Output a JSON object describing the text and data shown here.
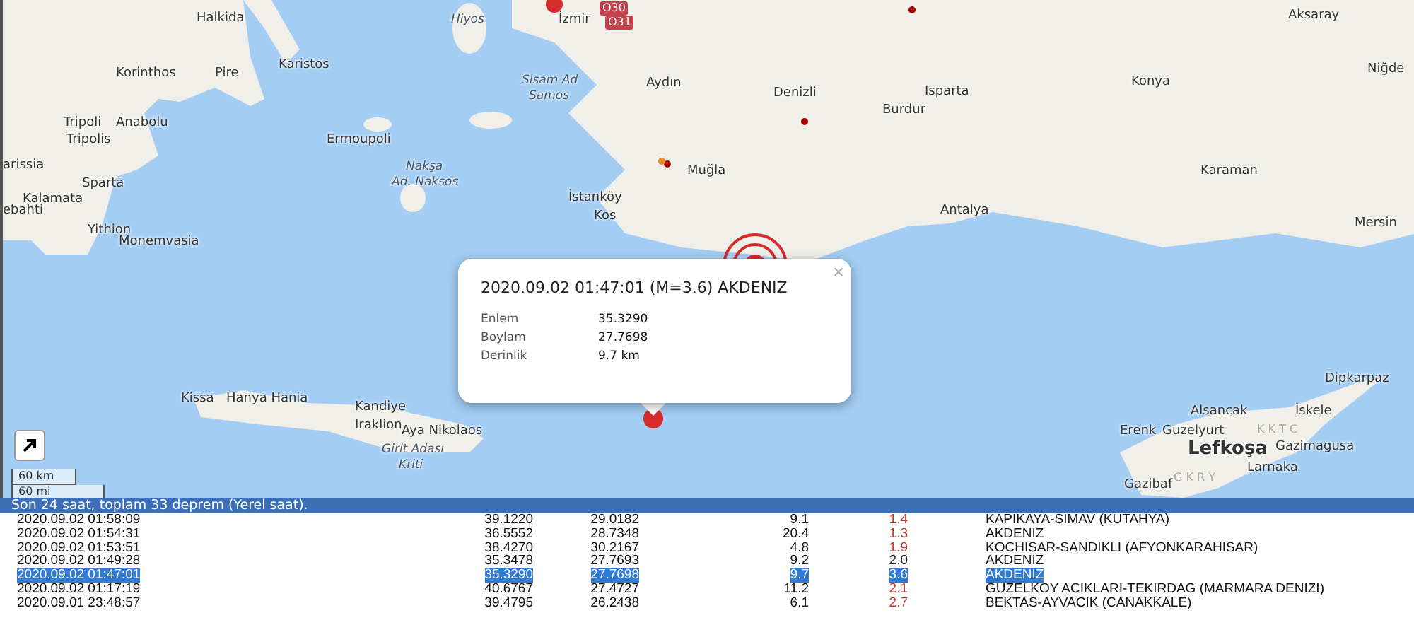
{
  "map": {
    "labels": [
      {
        "text": "Halkida",
        "kind": "city"
      },
      {
        "text": "Korinthos",
        "kind": "city"
      },
      {
        "text": "Pire",
        "kind": "city"
      },
      {
        "text": "Karistos",
        "kind": "city"
      },
      {
        "text": "Tripoli",
        "kind": "city"
      },
      {
        "text": "Anabolu",
        "kind": "city"
      },
      {
        "text": "Tripolis",
        "kind": "city"
      },
      {
        "text": "arissia",
        "kind": "city"
      },
      {
        "text": "Kalamata",
        "kind": "city"
      },
      {
        "text": "Sparta",
        "kind": "city"
      },
      {
        "text": "ebahti",
        "kind": "city"
      },
      {
        "text": "Yithion",
        "kind": "city"
      },
      {
        "text": "Monemvasia",
        "kind": "city"
      },
      {
        "text": "Ermoupoli",
        "kind": "city"
      },
      {
        "text": "Nakşa",
        "kind": "island"
      },
      {
        "text": "Ad. Naksos",
        "kind": "island"
      },
      {
        "text": "Hiyos",
        "kind": "island"
      },
      {
        "text": "İzmir",
        "kind": "city"
      },
      {
        "text": "Sisam Ad",
        "kind": "island"
      },
      {
        "text": "Samos",
        "kind": "island"
      },
      {
        "text": "Aydın",
        "kind": "city"
      },
      {
        "text": "İstanköy",
        "kind": "city"
      },
      {
        "text": "Kos",
        "kind": "city"
      },
      {
        "text": "Muğla",
        "kind": "city"
      },
      {
        "text": "Denizli",
        "kind": "city"
      },
      {
        "text": "Burdur",
        "kind": "city"
      },
      {
        "text": "Isparta",
        "kind": "city"
      },
      {
        "text": "Antalya",
        "kind": "city"
      },
      {
        "text": "Konya",
        "kind": "city"
      },
      {
        "text": "Aksaray",
        "kind": "city"
      },
      {
        "text": "Niğde",
        "kind": "city"
      },
      {
        "text": "Karaman",
        "kind": "city"
      },
      {
        "text": "Mersin",
        "kind": "city"
      },
      {
        "text": "Kissa",
        "kind": "city"
      },
      {
        "text": "Hanya Hania",
        "kind": "city"
      },
      {
        "text": "Kandiye",
        "kind": "city"
      },
      {
        "text": "Iraklion",
        "kind": "city"
      },
      {
        "text": "Aya Nikolaos",
        "kind": "city"
      },
      {
        "text": "Girit Adası",
        "kind": "island"
      },
      {
        "text": "Kriti",
        "kind": "island"
      },
      {
        "text": "Dipkarpaz",
        "kind": "city"
      },
      {
        "text": "Alsancak",
        "kind": "city"
      },
      {
        "text": "İskele",
        "kind": "city"
      },
      {
        "text": "Erenk",
        "kind": "city"
      },
      {
        "text": "Guzelyurt",
        "kind": "city"
      },
      {
        "text": "Lefkoşa",
        "kind": "capital"
      },
      {
        "text": "Gazimagusa",
        "kind": "city"
      },
      {
        "text": "Larnaka",
        "kind": "city"
      },
      {
        "text": "Gazibaf",
        "kind": "city"
      },
      {
        "text": "K K T C",
        "kind": "region"
      },
      {
        "text": "G K R Y",
        "kind": "region"
      }
    ],
    "road_badges": [
      "O30",
      "O31"
    ],
    "scale": [
      "60 km",
      "60 mi"
    ],
    "popup": {
      "title": "2020.09.02 01:47:01 (M=3.6) AKDENIZ",
      "close": "×",
      "fields": [
        {
          "label": "Enlem",
          "value": "35.3290"
        },
        {
          "label": "Boylam",
          "value": "27.7698"
        },
        {
          "label": "Derinlik",
          "value": "9.7 km"
        }
      ]
    }
  },
  "table": {
    "caption": "Son 24 saat, toplam 33 deprem (Yerel saat).",
    "rows": [
      {
        "date": "2020.09.02 01:58:09",
        "lat": "39.1220",
        "lon": "29.0182",
        "depth": "9.1",
        "mag": "1.4",
        "color": "#c0392b",
        "place": "KAPIKAYA-SIMAV (KUTAHYA)",
        "selected": false
      },
      {
        "date": "2020.09.02 01:54:31",
        "lat": "36.5552",
        "lon": "28.7348",
        "depth": "20.4",
        "mag": "1.3",
        "color": "#c0392b",
        "place": "AKDENIZ",
        "selected": false
      },
      {
        "date": "2020.09.02 01:53:51",
        "lat": "38.4270",
        "lon": "30.2167",
        "depth": "4.8",
        "mag": "1.9",
        "color": "#c0392b",
        "place": "KOCHISAR-SANDIKLI (AFYONKARAHISAR)",
        "selected": false
      },
      {
        "date": "2020.09.02 01:49:28",
        "lat": "35.3478",
        "lon": "27.7693",
        "depth": "9.2",
        "mag": "2.0",
        "color": "#222222",
        "place": "AKDENIZ",
        "selected": false
      },
      {
        "date": "2020.09.02 01:47:01",
        "lat": "35.3290",
        "lon": "27.7698",
        "depth": "9.7",
        "mag": "3.6",
        "place": "AKDENIZ",
        "selected": true
      },
      {
        "date": "2020.09.02 01:17:19",
        "lat": "40.6767",
        "lon": "27.4727",
        "depth": "11.2",
        "mag": "2.1",
        "color": "#c0392b",
        "place": "GUZELKOY ACIKLARI-TEKIRDAG (MARMARA DENIZI)",
        "selected": false
      },
      {
        "date": "2020.09.01 23:48:57",
        "lat": "39.4795",
        "lon": "26.2438",
        "depth": "6.1",
        "mag": "2.7",
        "color": "#c0392b",
        "place": "BEKTAS-AYVACIK (CANAKKALE)",
        "selected": false
      }
    ]
  }
}
